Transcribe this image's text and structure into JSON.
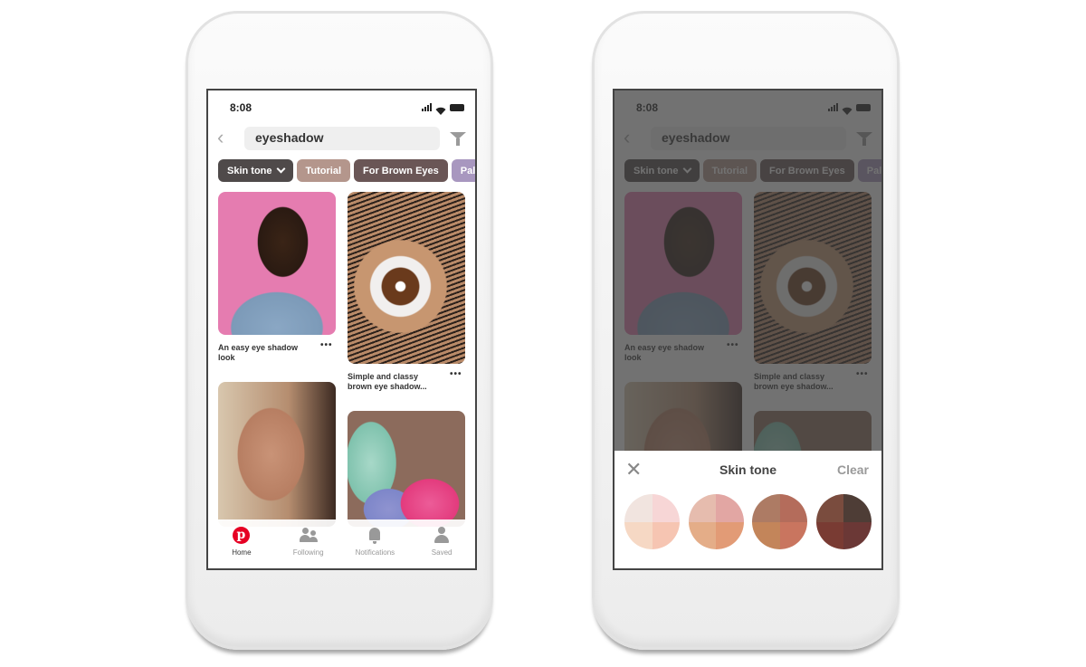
{
  "app": {
    "status_time": "8:08",
    "search_query": "eyeshadow",
    "chips": [
      {
        "label": "Skin tone",
        "color": "#4f4a4a",
        "has_dropdown": true
      },
      {
        "label": "Tutorial",
        "color": "#b4968c"
      },
      {
        "label": "For Brown Eyes",
        "color": "#6a5656"
      },
      {
        "label": "Pale",
        "color": "#a897bf"
      }
    ],
    "pins": [
      {
        "title": "An easy eye shadow look",
        "more": "•••"
      },
      {
        "title": "Simple and classy brown eye shadow...",
        "more": "•••"
      }
    ],
    "tabs": [
      {
        "label": "Home",
        "icon": "pinterest-logo-icon",
        "active": true
      },
      {
        "label": "Following",
        "icon": "people-icon"
      },
      {
        "label": "Notifications",
        "icon": "bell-icon"
      },
      {
        "label": "Saved",
        "icon": "person-icon"
      }
    ],
    "brand_color": "#e60023"
  },
  "skin_tone_sheet": {
    "title": "Skin tone",
    "close_icon": "close-icon",
    "clear_label": "Clear",
    "swatches": [
      {
        "name": "light",
        "quadrants": [
          "#f1e4df",
          "#f7d6d6",
          "#f6d8c4",
          "#f6c5b2"
        ]
      },
      {
        "name": "medium-light",
        "quadrants": [
          "#e6bcae",
          "#e2a6a3",
          "#e4ad88",
          "#e29b76"
        ]
      },
      {
        "name": "medium",
        "quadrants": [
          "#ad7b64",
          "#b46c5b",
          "#c3855a",
          "#c9755f"
        ]
      },
      {
        "name": "dark",
        "quadrants": [
          "#7a4c3e",
          "#4e3d36",
          "#793b33",
          "#6b3836"
        ]
      }
    ]
  }
}
